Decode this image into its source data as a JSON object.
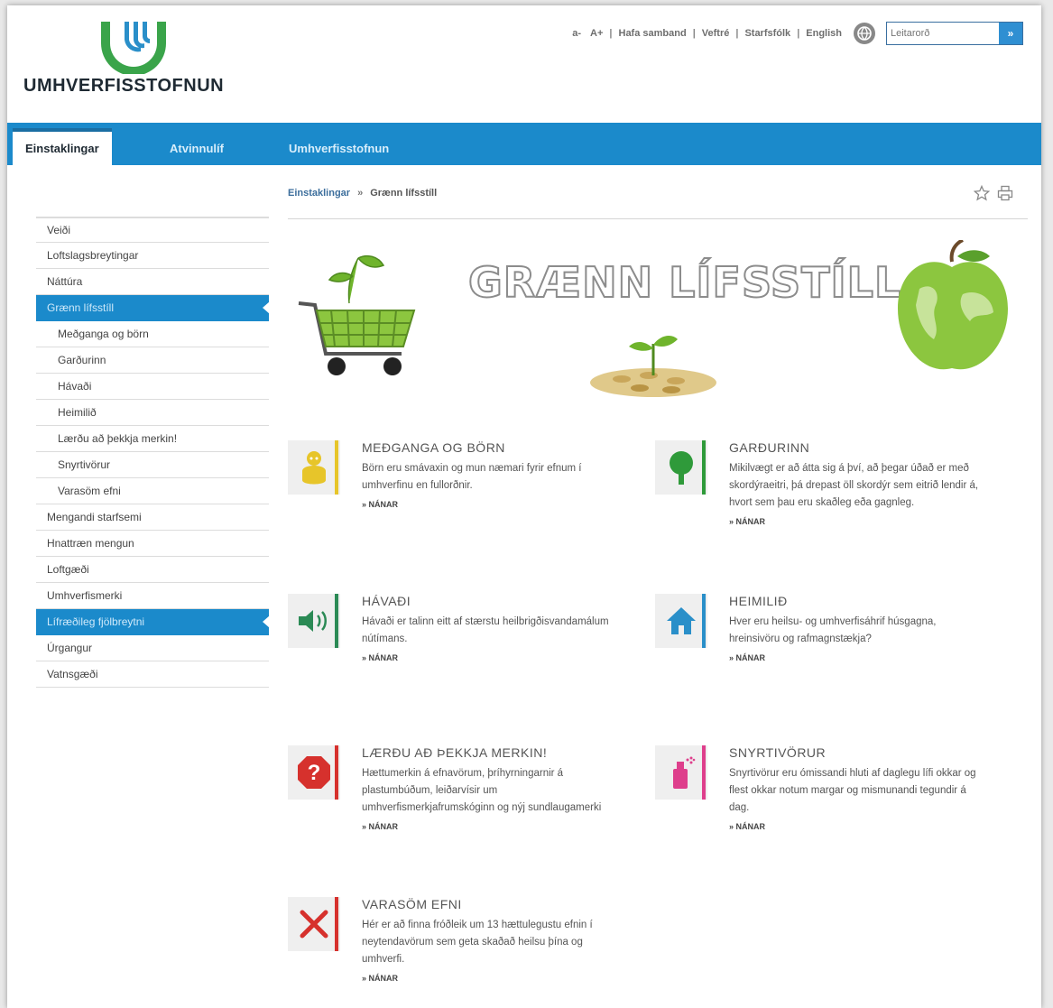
{
  "brand": {
    "name": "UMHVERFISSTOFNUN"
  },
  "utility": {
    "font_smaller": "a-",
    "font_larger": "A+",
    "sep": "|",
    "links": [
      "Hafa samband",
      "Veftré",
      "Starfsfólk",
      "English"
    ],
    "search_placeholder": "Leitarorð",
    "search_button": "»"
  },
  "nav": {
    "tabs": [
      "Einstaklingar",
      "Atvinnulíf",
      "Umhverfisstofnun"
    ]
  },
  "breadcrumb": {
    "home": "Einstaklingar",
    "arrow": "»",
    "current": "Grænn lífsstíll"
  },
  "sidebar": {
    "items": [
      "Veiði",
      "Loftslagsbreytingar",
      "Náttúra",
      "Grænn lífsstíll",
      "Meðganga og börn",
      "Garðurinn",
      "Hávaði",
      "Heimilið",
      "Lærðu að þekkja merkin!",
      "Snyrtivörur",
      "Varasöm efni",
      "Mengandi starfsemi",
      "Hnattræn mengun",
      "Loftgæði",
      "Umhverfismerki",
      "Lífræðileg fjölbreytni",
      "Úrgangur",
      "Vatnsgæði"
    ]
  },
  "banner": {
    "title": "GRÆNN LÍFSSTÍLL"
  },
  "cards": [
    {
      "title": "MEÐGANGA OG BÖRN",
      "text": "Börn eru smávaxin og mun næmari fyrir efnum í umhverfinu en fullorðnir.",
      "more": "» NÁNAR",
      "color": "#e7c52a",
      "icon": "baby-icon"
    },
    {
      "title": "GARÐURINN",
      "text": "Mikilvægt er að átta sig á því, að þegar úðað er með skordýraeitri, þá drepast öll skordýr sem eitrið lendir á, hvort sem þau eru skaðleg eða gagnleg.",
      "more": "» NÁNAR",
      "color": "#2f9a3a",
      "icon": "tree-icon"
    },
    {
      "title": "HÁVAÐI",
      "text": "Hávaði er talinn eitt af stærstu heilbrigðisvandamálum nútímans.",
      "more": "» NÁNAR",
      "color": "#2b8a55",
      "icon": "speaker-icon"
    },
    {
      "title": "HEIMILIÐ",
      "text": "Hver eru heilsu- og umhverfisáhrif húsgagna, hreinsivöru og rafmagnstækja?",
      "more": "» NÁNAR",
      "color": "#2a8fc9",
      "icon": "house-icon"
    },
    {
      "title": "LÆRÐU AÐ ÞEKKJA MERKIN!",
      "text": "Hættumerkin á efnavörum, þríhyrningarnir á plastumbúðum, leiðarvísir um umhverfismerkjafrumskóginn og nýj sundlaugamerki",
      "more": "» NÁNAR",
      "color": "#d6312d",
      "icon": "question-sign-icon"
    },
    {
      "title": "SNYRTIVÖRUR",
      "text": "Snyrtivörur eru ómissandi hluti af daglegu lífi okkar og flest okkar notum margar og mismunandi tegundir á dag.",
      "more": "» NÁNAR",
      "color": "#de3f8c",
      "icon": "perfume-icon"
    },
    {
      "title": "VARASÖM EFNI",
      "text": "Hér er að finna fróðleik um 13 hættulegustu efnin í neytendavörum sem geta skaðað heilsu þína og umhverfi.",
      "more": "» NÁNAR",
      "color": "#d6312d",
      "icon": "cross-icon"
    }
  ],
  "colors": {
    "nav_blue": "#1b8acb",
    "logo_green": "#3aa44a",
    "logo_blue": "#2a8fc9"
  }
}
